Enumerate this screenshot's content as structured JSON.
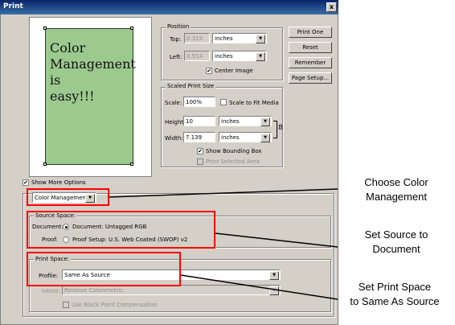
{
  "dialog": {
    "title": "Print",
    "close_glyph": "x"
  },
  "preview": {
    "text_lines": [
      "Color",
      "Management",
      "is",
      "easy!!!"
    ]
  },
  "position": {
    "group_label": "Position",
    "top_label": "Top:",
    "top_value": "0.319",
    "top_unit": "inches",
    "left_label": "Left:",
    "left_value": "0.514",
    "left_unit": "inches",
    "center_image_label": "Center Image",
    "center_image_checked": true
  },
  "scaled": {
    "group_label": "Scaled Print Size",
    "scale_label": "Scale:",
    "scale_value": "100%",
    "scale_fit_label": "Scale to Fit Media",
    "height_label": "Height:",
    "height_value": "10",
    "height_unit": "inches",
    "width_label": "Width:",
    "width_value": "7.139",
    "width_unit": "inches",
    "link_icon": "8",
    "show_bbox_label": "Show Bounding Box",
    "show_bbox_checked": true,
    "print_selected_label": "Print Selected Area"
  },
  "buttons": {
    "print_one": "Print One",
    "reset": "Reset",
    "remember": "Remember",
    "page_setup": "Page Setup..."
  },
  "more_options": {
    "label": "Show More Options",
    "checked": true,
    "mode_value": "Color Management"
  },
  "source_space": {
    "group_label": "Source Space:",
    "document_row_label": "Document:",
    "document_option": "Document:  Untagged RGB",
    "proof_row_label": "Proof:",
    "proof_option": "Proof Setup:  U.S. Web Coated (SWOP) v2"
  },
  "print_space": {
    "group_label": "Print Space:",
    "profile_label": "Profile:",
    "profile_value": "Same As Source",
    "intent_label": "Intent:",
    "intent_value": "Relative Colorimetric",
    "bpc_label": "Use Black Point Compensation"
  },
  "callouts": {
    "c1": [
      "Choose Color",
      "Management"
    ],
    "c2": [
      "Set Source to",
      "Document"
    ],
    "c3": [
      "Set Print Space",
      "to Same As Source"
    ]
  },
  "colors": {
    "highlight": "#ff0000",
    "dialog_bg": "#d4d0c8",
    "preview_fill": "#9cc98e",
    "titlebar": "#0a246a"
  }
}
